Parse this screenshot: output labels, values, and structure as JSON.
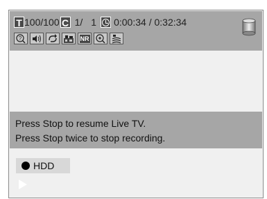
{
  "status": {
    "title_badge": "T",
    "title_value": "100/100",
    "chapter_badge": "C",
    "chapter_value": "1/",
    "chapter_total": "1",
    "time_elapsed": "0:00:34",
    "time_separator": " / ",
    "time_total": "0:32:34"
  },
  "tools": [
    {
      "name": "help-icon"
    },
    {
      "name": "audio-icon"
    },
    {
      "name": "repeat-icon"
    },
    {
      "name": "picture-quality-icon"
    },
    {
      "name": "noise-reduction-icon",
      "label": "NR"
    },
    {
      "name": "zoom-icon"
    },
    {
      "name": "surround-icon"
    }
  ],
  "message": {
    "line1": "Press Stop to resume Live TV.",
    "line2": "Press Stop twice to stop recording."
  },
  "device": {
    "label": "HDD"
  },
  "colors": {
    "panel": "#a6a6a6",
    "background": "#f0f0f0",
    "badge": "#4a4a4a"
  }
}
